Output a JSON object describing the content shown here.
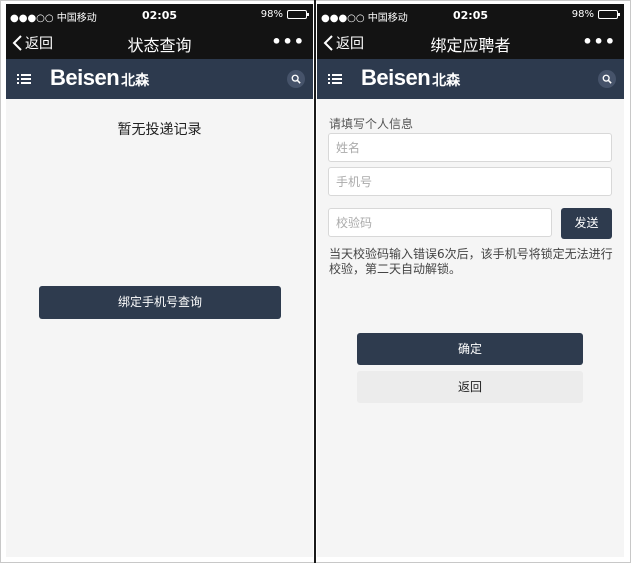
{
  "left": {
    "status": {
      "signal": "●●●○○ 中国移动",
      "wifi": "wifi-icon",
      "time": "02:05",
      "battery": "98%"
    },
    "nav": {
      "back_label": "返回",
      "title": "状态查询",
      "more": "•••"
    },
    "brand": {
      "logo_en": "Beisen",
      "logo_cn": "北森"
    },
    "content": {
      "empty_text": "暂无投递记录",
      "bind_button": "绑定手机号查询"
    }
  },
  "right": {
    "status": {
      "signal": "●●●○○ 中国移动",
      "wifi": "wifi-icon",
      "time": "02:05",
      "battery": "98%"
    },
    "nav": {
      "back_label": "返回",
      "title": "绑定应聘者",
      "more": "•••"
    },
    "brand": {
      "logo_en": "Beisen",
      "logo_cn": "北森"
    },
    "form": {
      "section_label": "请填写个人信息",
      "name_placeholder": "姓名",
      "phone_placeholder": "手机号",
      "code_placeholder": "校验码",
      "send_button": "发送",
      "hint": "当天校验码输入错误6次后，该手机号将锁定无法进行校验，第二天自动解锁。",
      "confirm_button": "确定",
      "back_button": "返回"
    }
  },
  "colors": {
    "nav_bg": "#131313",
    "brand_bg": "#2d3a4e",
    "primary_button": "#2e3b4e"
  }
}
